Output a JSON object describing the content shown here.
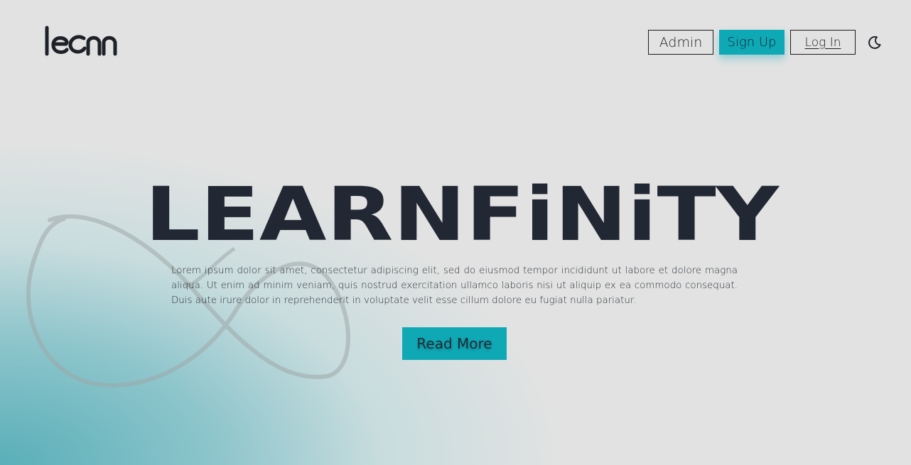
{
  "header": {
    "logo_text": "learn",
    "nav": {
      "admin_label": "Admin",
      "signup_label": "Sign Up",
      "login_label": "Log In"
    },
    "theme_toggle_icon": "moon-icon"
  },
  "hero": {
    "title": "LEARNFiNiTY",
    "description": "Lorem ipsum dolor sit amet, consectetur adipiscing elit, sed do eiusmod tempor incididunt ut labore et dolore magna aliqua. Ut enim ad minim veniam, quis nostrud exercitation ullamco laboris nisi ut aliquip ex ea commodo consequat. Duis aute irure dolor in reprehenderit in voluptate velit esse cillum dolore eu fugiat nulla pariatur.",
    "cta_label": "Read More"
  },
  "colors": {
    "accent": "#0fa9b6",
    "text_dark": "#222833",
    "background": "#e2e2e2",
    "gradient_teal": "#52acb6"
  }
}
